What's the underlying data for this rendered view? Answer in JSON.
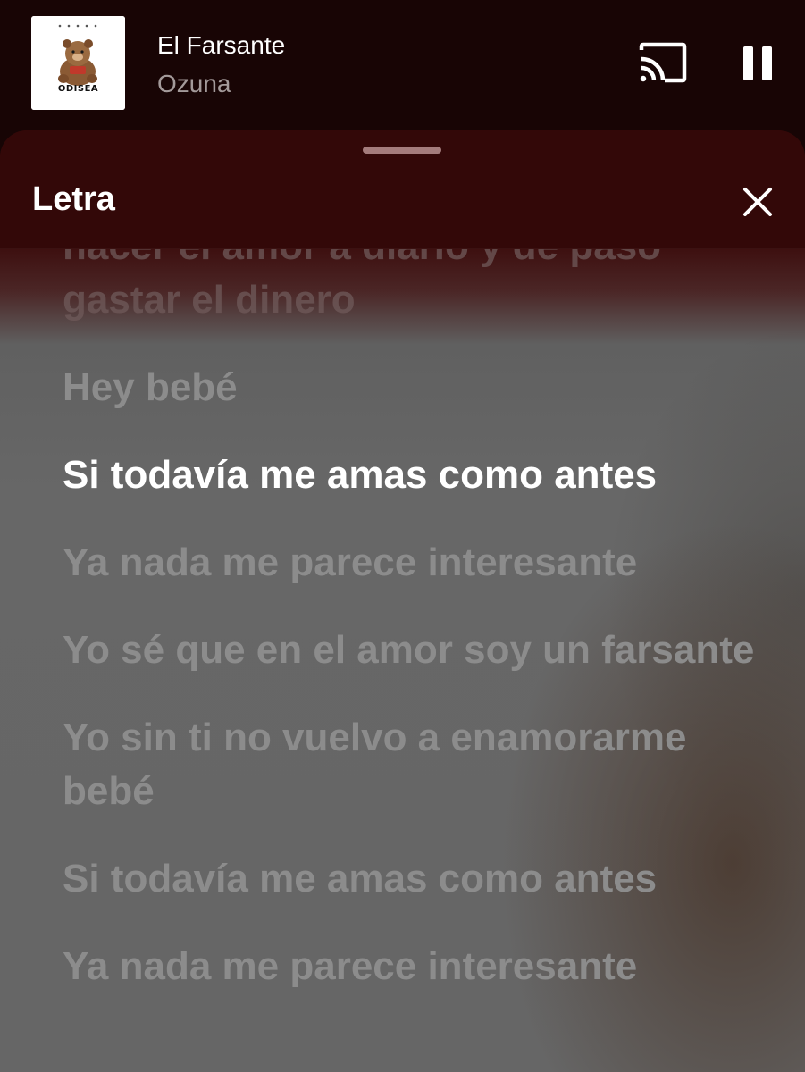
{
  "player": {
    "album_art_text": "ODISEA",
    "title": "El Farsante",
    "artist": "Ozuna",
    "cast_icon": "cast-icon",
    "pause_icon": "pause-icon"
  },
  "sheet": {
    "title": "Letra",
    "close_icon": "close-icon"
  },
  "lyrics": {
    "lines": [
      "hacer el amor a diario y de paso gastar el dinero",
      "Hey bebé",
      "Si todavía me amas como antes",
      "Ya nada me parece interesante",
      "Yo sé que en el amor soy un farsante",
      "Yo sin ti no vuelvo a enamorarme bebé",
      "Si todavía me amas como antes",
      "Ya nada me parece interesante"
    ],
    "active_index": 2
  },
  "colors": {
    "header_bg": "#180505",
    "sheet_header_bg": "#330808",
    "lyrics_bg": "#666666",
    "active_text": "#ffffff",
    "inactive_text": "#8c8c8c"
  }
}
